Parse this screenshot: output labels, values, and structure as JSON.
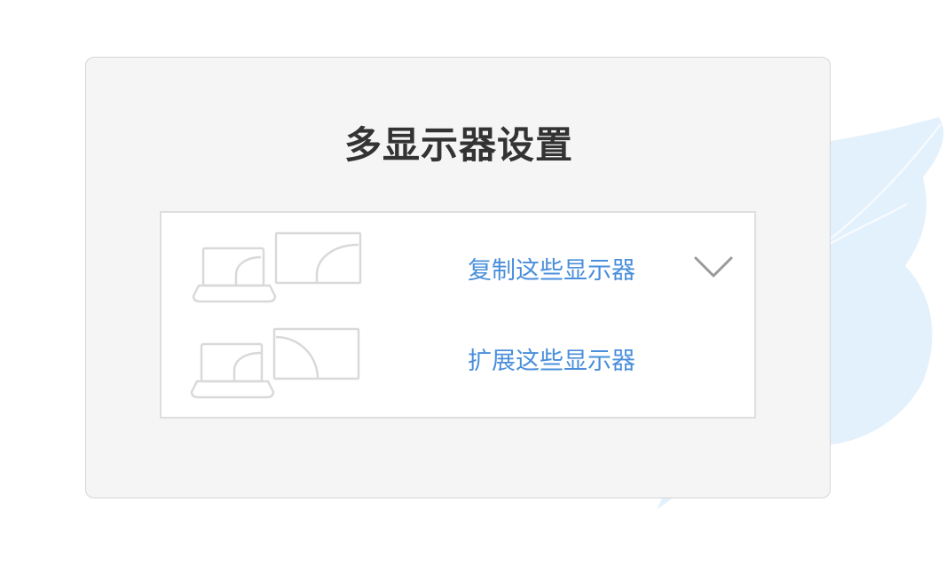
{
  "dialog": {
    "title": "多显示器设置"
  },
  "options": [
    {
      "label": "复制这些显示器",
      "icon": "duplicate-displays-icon"
    },
    {
      "label": "扩展这些显示器",
      "icon": "extend-displays-icon"
    }
  ],
  "dropdown": {
    "icon": "chevron-down-icon"
  },
  "colors": {
    "card_bg": "#f5f5f5",
    "panel_bg": "#ffffff",
    "link": "#4a8fdb",
    "title": "#333333",
    "icon_stroke": "#d9d9d9",
    "leaf": "#e3f1fc"
  }
}
